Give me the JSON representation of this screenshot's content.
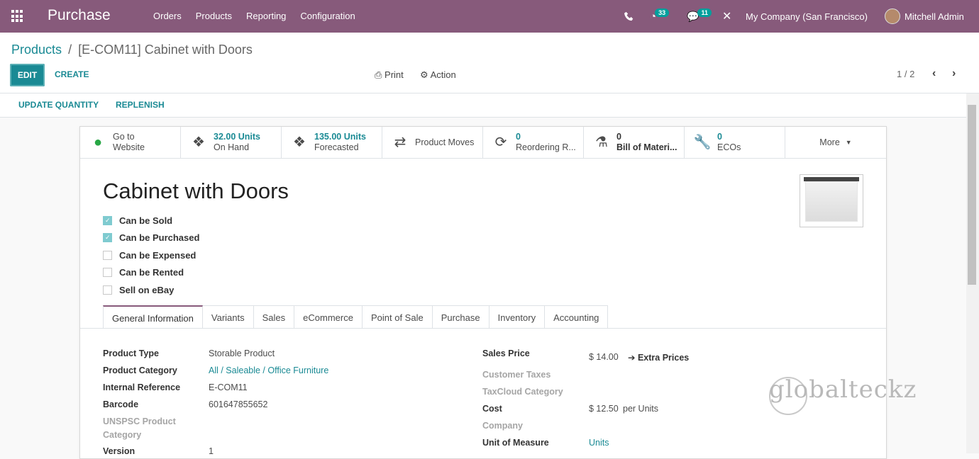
{
  "topbar": {
    "app_name": "Purchase",
    "menu": [
      "Orders",
      "Products",
      "Reporting",
      "Configuration"
    ],
    "activity_count": "33",
    "messages_count": "11",
    "company": "My Company (San Francisco)",
    "user": "Mitchell Admin"
  },
  "breadcrumb": {
    "parent": "Products",
    "separator": "/",
    "current": "[E-COM11] Cabinet with Doors"
  },
  "toolbar": {
    "edit": "EDIT",
    "create": "CREATE",
    "print": "Print",
    "action": "Action",
    "pager": "1 / 2"
  },
  "statusbar": {
    "update_qty": "UPDATE QUANTITY",
    "replenish": "REPLENISH"
  },
  "smart_buttons": [
    {
      "icon": "globe-icon",
      "top": "Go to",
      "bottom": "Website"
    },
    {
      "icon": "cubes-icon",
      "top": "32.00 Units",
      "bottom": "On Hand"
    },
    {
      "icon": "cubes-icon",
      "top": "135.00 Units",
      "bottom": "Forecasted"
    },
    {
      "icon": "exchange-icon",
      "top": "Product Moves",
      "bottom": ""
    },
    {
      "icon": "refresh-icon",
      "top": "0",
      "bottom": "Reordering R..."
    },
    {
      "icon": "flask-icon",
      "top": "0",
      "bottom": "Bill of Materi..."
    },
    {
      "icon": "wrench-icon",
      "top": "0",
      "bottom": "ECOs"
    },
    {
      "icon": "caret-down-icon",
      "top": "More",
      "bottom": ""
    }
  ],
  "product": {
    "name": "Cabinet with Doors"
  },
  "options": [
    {
      "label": "Can be Sold",
      "checked": true
    },
    {
      "label": "Can be Purchased",
      "checked": true
    },
    {
      "label": "Can be Expensed",
      "checked": false
    },
    {
      "label": "Can be Rented",
      "checked": false
    },
    {
      "label": "Sell on eBay",
      "checked": false
    }
  ],
  "tabs": [
    "General Information",
    "Variants",
    "Sales",
    "eCommerce",
    "Point of Sale",
    "Purchase",
    "Inventory",
    "Accounting"
  ],
  "left_fields": {
    "product_type_label": "Product Type",
    "product_type": "Storable Product",
    "category_label": "Product Category",
    "category": "All / Saleable / Office Furniture",
    "internal_ref_label": "Internal Reference",
    "internal_ref": "E-COM11",
    "barcode_label": "Barcode",
    "barcode": "601647855652",
    "unspsc_label_1": "UNSPSC Product",
    "unspsc_label_2": "Category",
    "version_label": "Version",
    "version": "1"
  },
  "right_fields": {
    "sales_price_label": "Sales Price",
    "sales_price": "$ 14.00",
    "extra_prices": "Extra Prices",
    "customer_taxes_label": "Customer Taxes",
    "taxcloud_label": "TaxCloud Category",
    "cost_label": "Cost",
    "cost": "$ 12.50",
    "cost_unit": "per Units",
    "company_label": "Company",
    "uom_label": "Unit of Measure",
    "uom": "Units"
  },
  "watermark": "globalteckz",
  "colors": {
    "brand": "#875a7b",
    "accent": "#1a8a94"
  }
}
